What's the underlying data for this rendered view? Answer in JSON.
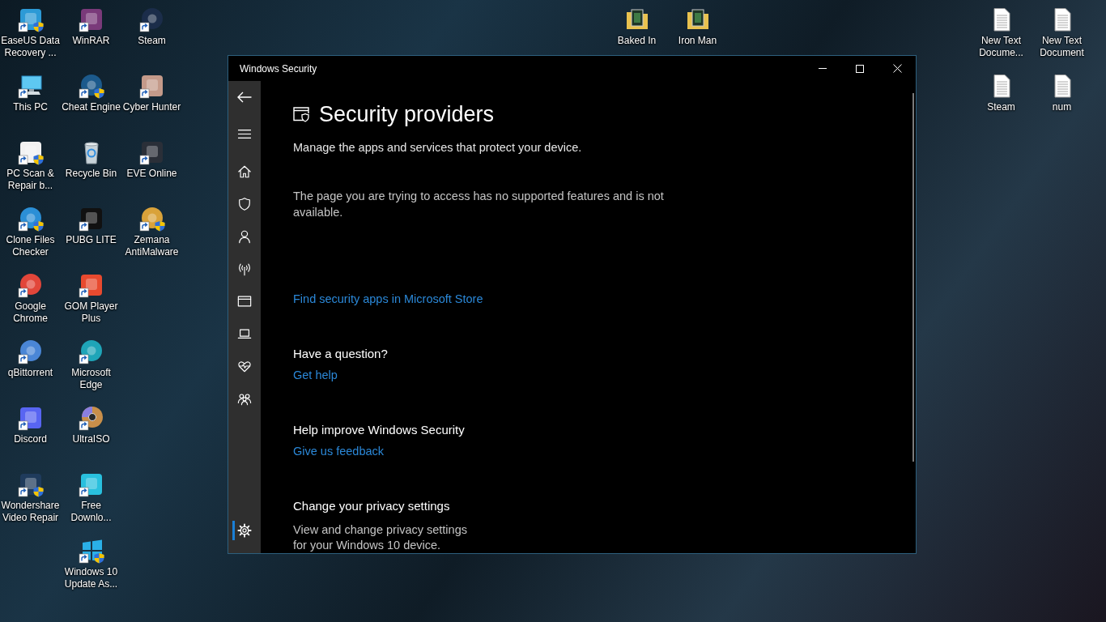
{
  "desktop": {
    "left_columns": [
      [
        {
          "label": "EaseUS Data Recovery ...",
          "kind": "tile",
          "color": "#2c9ad6",
          "shortcut": true,
          "shield": true
        },
        {
          "label": "This PC",
          "kind": "computer",
          "shortcut": true,
          "shield": false
        },
        {
          "label": "PC Scan & Repair b...",
          "kind": "tile",
          "color": "#f2f2f2",
          "shortcut": true,
          "shield": true
        },
        {
          "label": "Clone Files Checker",
          "kind": "round",
          "color": "#2b8fd6",
          "shortcut": true,
          "shield": true
        },
        {
          "label": "Google Chrome",
          "kind": "round",
          "color": "#e2463a",
          "shortcut": true,
          "shield": false
        },
        {
          "label": "qBittorrent",
          "kind": "round",
          "color": "#4a86d6",
          "shortcut": true,
          "shield": false
        },
        {
          "label": "Discord",
          "kind": "tile",
          "color": "#5865f2",
          "shortcut": true,
          "shield": false
        },
        {
          "label": "Wondershare Video Repair",
          "kind": "tile",
          "color": "#1f3b5c",
          "shortcut": true,
          "shield": true
        }
      ],
      [
        {
          "label": "WinRAR",
          "kind": "tile",
          "color": "#7a3a7a",
          "shortcut": true,
          "shield": false
        },
        {
          "label": "Cheat Engine",
          "kind": "round",
          "color": "#1c5a8c",
          "shortcut": true,
          "shield": true
        },
        {
          "label": "Recycle Bin",
          "kind": "bin",
          "shortcut": false,
          "shield": false
        },
        {
          "label": "PUBG LITE",
          "kind": "tile",
          "color": "#111111",
          "shortcut": true,
          "shield": false
        },
        {
          "label": "GOM Player Plus",
          "kind": "tile",
          "color": "#e84a2f",
          "shortcut": true,
          "shield": false
        },
        {
          "label": "Microsoft Edge",
          "kind": "round",
          "color": "#1fa5b8",
          "shortcut": true,
          "shield": false
        },
        {
          "label": "UltraISO",
          "kind": "disc",
          "shortcut": true,
          "shield": false
        },
        {
          "label": "Free Downlo...",
          "kind": "tile",
          "color": "#29c0de",
          "shortcut": true,
          "shield": false
        },
        {
          "label": "Windows 10 Update As...",
          "kind": "panes",
          "shortcut": true,
          "shield": true
        }
      ],
      [
        {
          "label": "Steam",
          "kind": "round",
          "color": "#1b2d4a",
          "shortcut": true,
          "shield": false
        },
        {
          "label": "Cyber Hunter",
          "kind": "tile",
          "color": "#c49a8a",
          "shortcut": true,
          "shield": false
        },
        {
          "label": "EVE Online",
          "kind": "tile",
          "color": "#2a2f38",
          "shortcut": true,
          "shield": false
        },
        {
          "label": "Zemana AntiMalware",
          "kind": "round",
          "color": "#d9a23a",
          "shortcut": true,
          "shield": true
        }
      ]
    ],
    "top_columns": [
      [
        {
          "label": "Baked In",
          "kind": "folder",
          "shortcut": false,
          "shield": false
        }
      ],
      [
        {
          "label": "Iron Man",
          "kind": "folder",
          "shortcut": false,
          "shield": false
        }
      ]
    ],
    "right_columns": [
      [
        {
          "label": "New Text Docume...",
          "kind": "document",
          "shortcut": false,
          "shield": false
        },
        {
          "label": "Steam",
          "kind": "document",
          "shortcut": false,
          "shield": false
        }
      ],
      [
        {
          "label": "New Text Document",
          "kind": "document",
          "shortcut": false,
          "shield": false
        },
        {
          "label": "num",
          "kind": "document",
          "shortcut": false,
          "shield": false
        }
      ]
    ]
  },
  "window": {
    "title": "Windows Security",
    "nav": {
      "items": [
        {
          "kind": "home",
          "selected": false
        },
        {
          "kind": "shield",
          "selected": false
        },
        {
          "kind": "person",
          "selected": false
        },
        {
          "kind": "antenna",
          "selected": false
        },
        {
          "kind": "browser",
          "selected": false
        },
        {
          "kind": "laptop",
          "selected": false
        },
        {
          "kind": "heart",
          "selected": false
        },
        {
          "kind": "family",
          "selected": false
        }
      ],
      "bottom_items": [
        {
          "kind": "gear",
          "selected": true
        }
      ]
    },
    "page": {
      "title": "Security providers",
      "subtitle": "Manage the apps and services that protect your device.",
      "notice": "The page you are trying to access has no supported features and is not available.",
      "store_link": "Find security apps in Microsoft Store",
      "sections": [
        {
          "heading": "Have a question?",
          "link": "Get help"
        },
        {
          "heading": "Help improve Windows Security",
          "link": "Give us feedback"
        },
        {
          "heading": "Change your privacy settings",
          "text": "View and change privacy settings for your Windows 10 device."
        }
      ]
    }
  }
}
